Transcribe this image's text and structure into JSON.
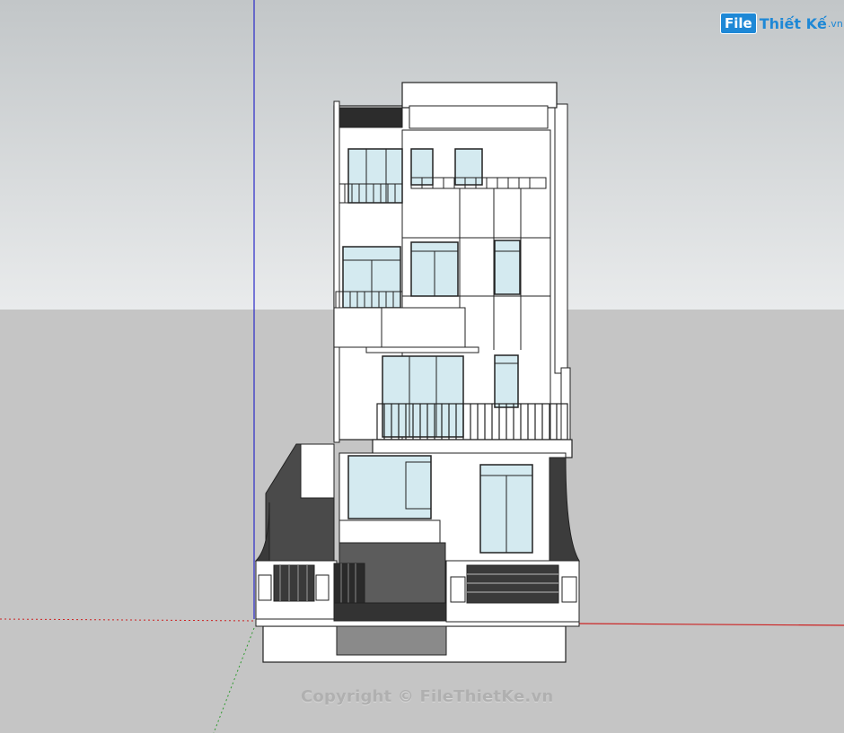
{
  "watermark": {
    "logo_badge": "File",
    "logo_name": "Thiết Kế",
    "logo_tld": ".vn",
    "copyright": "Copyright © FileThietKe.vn"
  },
  "colors": {
    "sky": "#dfe2e3",
    "ground": "#c5c5c5",
    "axis_blue": "#2a2ac8",
    "axis_red": "#cc2222",
    "axis_green": "#2e9a2e",
    "glass": "#d4eaf0",
    "wall": "#ffffff",
    "dark_wall": "#3b3b3b",
    "brand": "#1e88d6"
  }
}
